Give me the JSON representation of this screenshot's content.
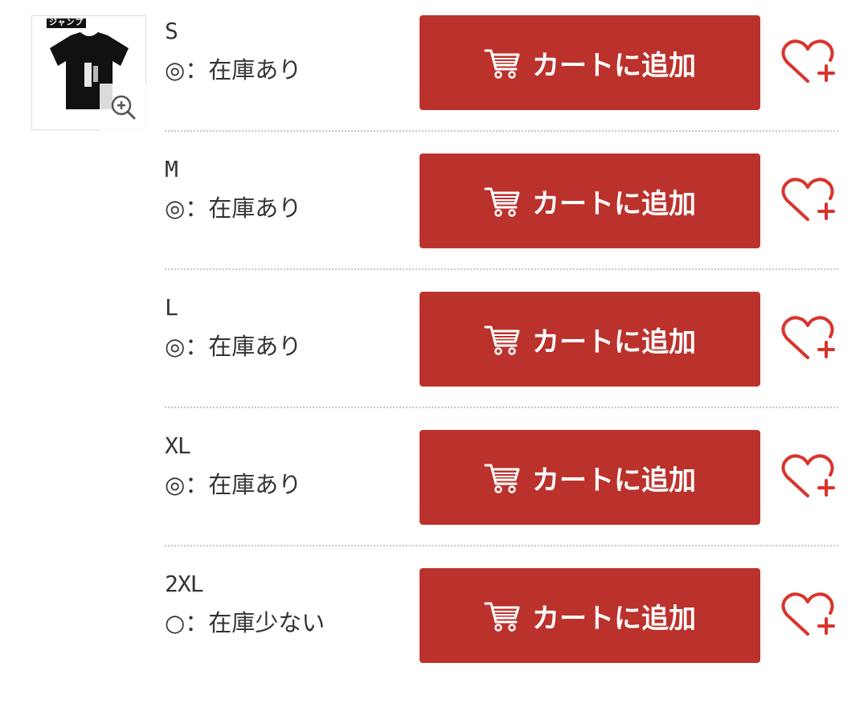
{
  "product": {
    "thumbnail_icon": "tshirt-image",
    "logo_text": "ジャンプ",
    "zoom_icon": "zoom-in-icon"
  },
  "variants": [
    {
      "size": "S",
      "stock": "◎：在庫あり",
      "button_label": "カートに追加",
      "cart_icon": "cart-icon",
      "favorite_icon": "heart-plus-icon"
    },
    {
      "size": "M",
      "stock": "◎：在庫あり",
      "button_label": "カートに追加",
      "cart_icon": "cart-icon",
      "favorite_icon": "heart-plus-icon"
    },
    {
      "size": "L",
      "stock": "◎：在庫あり",
      "button_label": "カートに追加",
      "cart_icon": "cart-icon",
      "favorite_icon": "heart-plus-icon"
    },
    {
      "size": "XL",
      "stock": "◎：在庫あり",
      "button_label": "カートに追加",
      "cart_icon": "cart-icon",
      "favorite_icon": "heart-plus-icon"
    },
    {
      "size": "2XL",
      "stock": "○：在庫少ない",
      "button_label": "カートに追加",
      "cart_icon": "cart-icon",
      "favorite_icon": "heart-plus-icon"
    }
  ],
  "colors": {
    "button_bg": "#bb322c",
    "button_text": "#ffffff",
    "heart": "#d9342b",
    "divider": "#c7c7c7"
  }
}
